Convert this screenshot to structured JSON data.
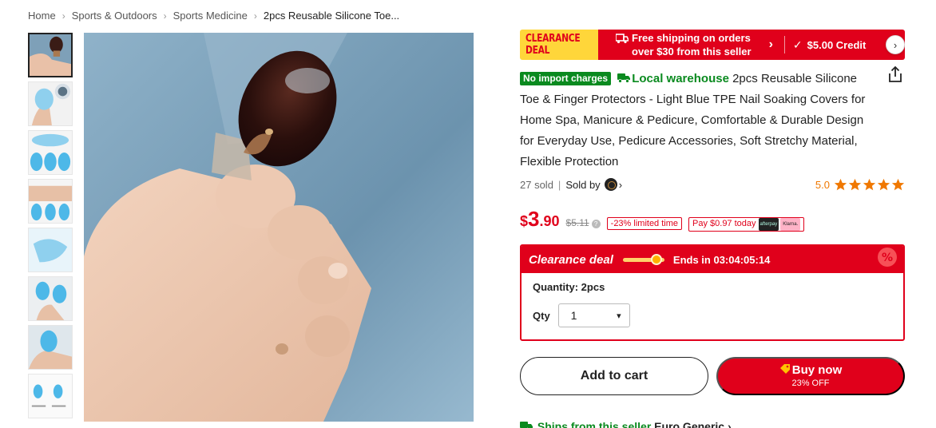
{
  "breadcrumb": {
    "items": [
      "Home",
      "Sports & Outdoors",
      "Sports Medicine",
      "2pcs Reusable Silicone Toe..."
    ],
    "separator": "›"
  },
  "thumbnails": [
    {
      "alt": "toe with brown silicone cap",
      "active": true
    },
    {
      "alt": "blue toe cap on finger"
    },
    {
      "alt": "three blue toe caps"
    },
    {
      "alt": "foot with caps and three caps"
    },
    {
      "alt": "blue cap closeup"
    },
    {
      "alt": "blue caps on fingers"
    },
    {
      "alt": "blue toe cap on toe"
    },
    {
      "alt": "size diagram"
    }
  ],
  "promo": {
    "clearance_line1": "CLEARANCE",
    "clearance_line2": "DEAL",
    "shipping_line1": "Free shipping on orders",
    "shipping_line2": "over $30 from this seller",
    "chevron": "›",
    "check": "✓",
    "credit": "$5.00 Credit",
    "next": "›"
  },
  "product": {
    "badge_import": "No import charges",
    "local_warehouse": "Local warehouse",
    "title": " 2pcs Reusable Silicone Toe & Finger Protectors - Light Blue TPE Nail Soaking Covers for Home Spa, Manicure & Pedicure, Comfortable & Durable Design for Everyday Use, Pedicure Accessories, Soft Stretchy Material, Flexible Protection",
    "sold": "27 sold",
    "sep": "|",
    "sold_by": "Sold by",
    "chevron": "›",
    "rating": "5.0",
    "stars": 5
  },
  "price": {
    "currency": "$",
    "integer": "3",
    "decimal": ".90",
    "original": "$5.11",
    "info": "?",
    "discount": "-23% limited time",
    "pay_today": "Pay $0.97 today",
    "afterpay": "afterpay",
    "klarna": "Klarna."
  },
  "deal": {
    "title": "Clearance deal",
    "ends": "Ends in 03:04:05:14",
    "progress": 0.8,
    "quantity_label": "Quantity: 2pcs",
    "qty_label": "Qty",
    "qty_value": "1",
    "qty_arrow": "⌄"
  },
  "buttons": {
    "add_to_cart": "Add to cart",
    "buy_now": "Buy now",
    "buy_sub": "23% OFF"
  },
  "ship_from": {
    "label": "Ships from this seller",
    "seller": "Euro Generic",
    "chevron": "›"
  },
  "colors": {
    "brand_red": "#e0001b",
    "green": "#0a8a1f",
    "star": "#f07800",
    "yellow": "#ffd63a"
  }
}
